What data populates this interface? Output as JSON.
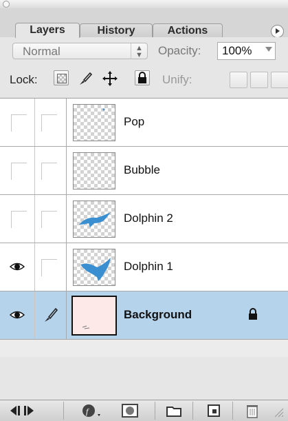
{
  "window": {
    "close_icon": "close-circle-icon"
  },
  "tabs": [
    {
      "label": "Layers",
      "active": true
    },
    {
      "label": "History",
      "active": false
    },
    {
      "label": "Actions",
      "active": false
    }
  ],
  "panel_menu_icon": "right-arrow-circle-icon",
  "blend": {
    "mode": "Normal",
    "opacity_label": "Opacity:",
    "opacity_value": "100%"
  },
  "lock": {
    "label": "Lock:",
    "unify_label": "Unify:"
  },
  "layers": [
    {
      "name": "Pop",
      "visible": false,
      "thumb": "transparent",
      "selected": false,
      "locked": false
    },
    {
      "name": "Bubble",
      "visible": false,
      "thumb": "transparent",
      "selected": false,
      "locked": false
    },
    {
      "name": "Dolphin 2",
      "visible": false,
      "thumb": "dolphin",
      "selected": false,
      "locked": false
    },
    {
      "name": "Dolphin 1",
      "visible": true,
      "thumb": "dolphin",
      "selected": false,
      "locked": false
    },
    {
      "name": "Background",
      "visible": true,
      "thumb": "background",
      "selected": true,
      "locked": true
    }
  ],
  "colors": {
    "selected_row": "#b6d3ec",
    "dolphin": "#3a8fd0"
  },
  "bottom_toolbar_icons": [
    "link-layers-icon",
    "layer-style-icon",
    "mask-icon",
    "new-group-icon",
    "new-layer-icon",
    "trash-icon"
  ]
}
